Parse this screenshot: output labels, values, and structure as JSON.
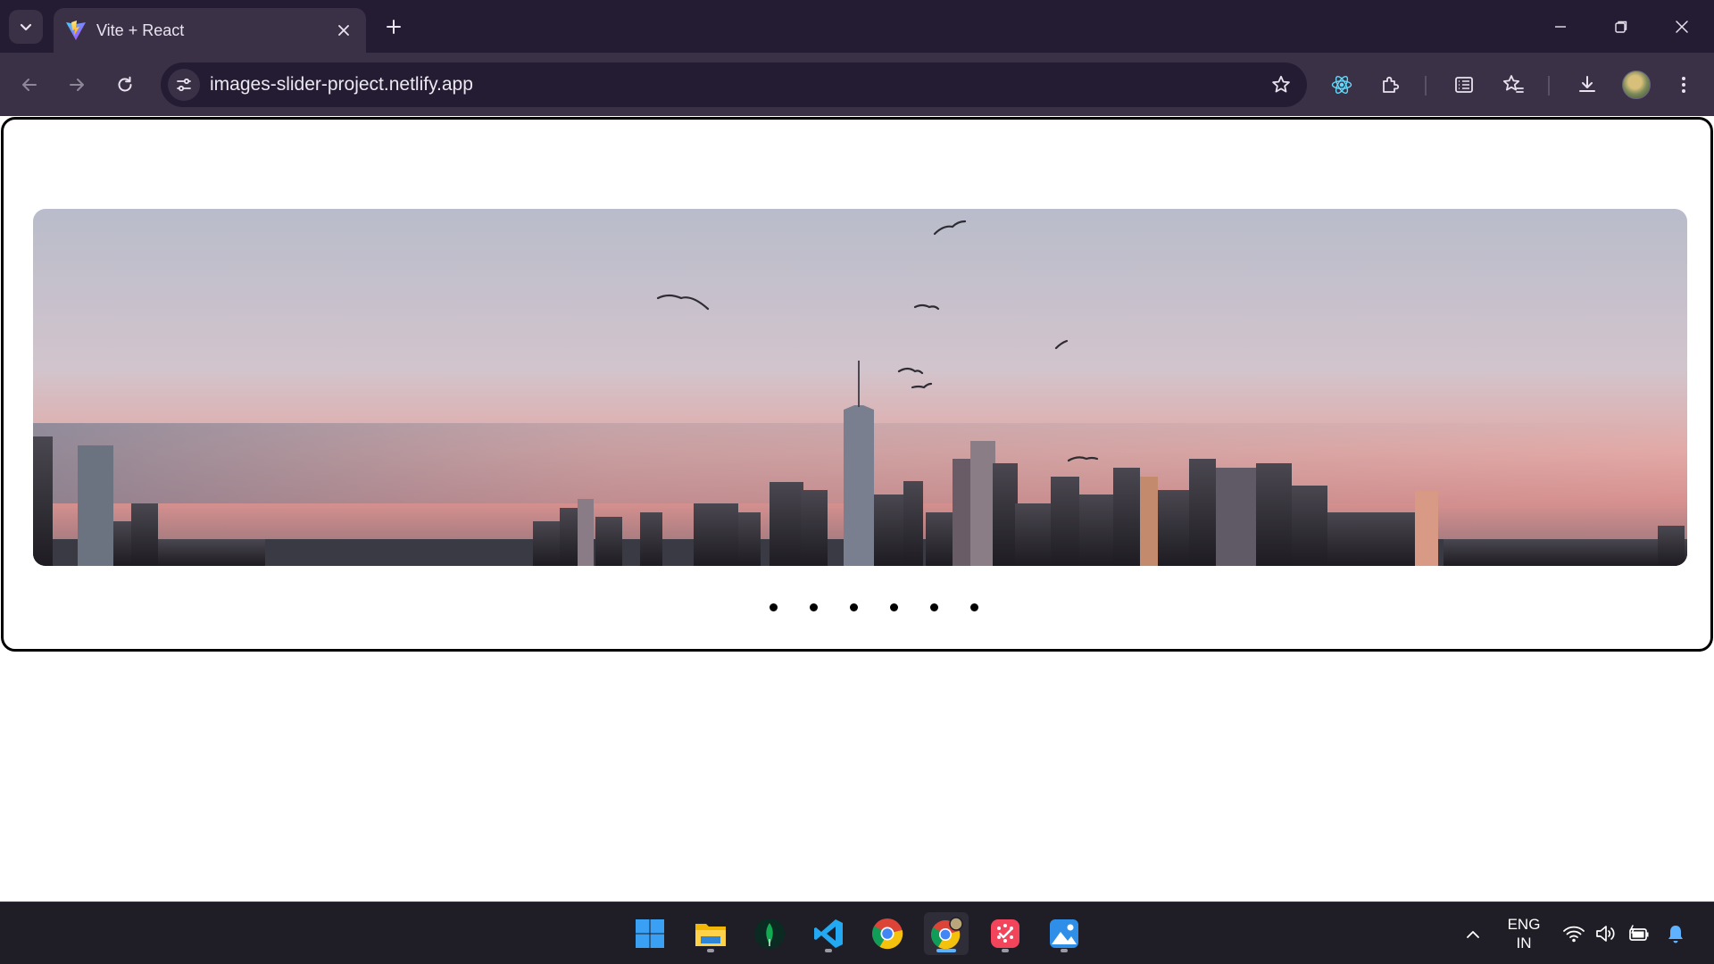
{
  "browser": {
    "tab": {
      "title": "Vite + React",
      "favicon": "vite-logo-icon"
    },
    "address_bar": {
      "url": "images-slider-project.netlify.app"
    },
    "toolbar_icons": [
      "back-arrow-icon",
      "forward-arrow-icon",
      "reload-icon",
      "site-info-icon",
      "bookmark-star-icon",
      "react-devtools-icon",
      "extensions-puzzle-icon",
      "reading-list-icon",
      "bookmarks-star-icon",
      "download-icon",
      "profile-avatar",
      "more-menu-icon"
    ],
    "colors": {
      "tabbar": "#241c33",
      "toolbar": "#3a3147",
      "omnibox": "#241c33"
    }
  },
  "slider": {
    "image_label": "city skyline at dusk with birds",
    "dot_count": 6,
    "dots": [
      "slide-1",
      "slide-2",
      "slide-3",
      "slide-4",
      "slide-5",
      "slide-6"
    ],
    "frame_border_color": "#000000"
  },
  "taskbar": {
    "apps": [
      "windows-start-icon",
      "file-explorer-icon",
      "mongodb-compass-icon",
      "vscode-icon",
      "chrome-icon",
      "chrome-profile-icon",
      "snipping-app-icon",
      "photos-app-icon"
    ],
    "active_app": "chrome-profile-icon",
    "language": {
      "line1": "ENG",
      "line2": "IN"
    },
    "tray_icons": [
      "show-hidden-icons-chevron",
      "wifi-icon",
      "volume-icon",
      "battery-icon",
      "notification-bell-icon"
    ]
  }
}
